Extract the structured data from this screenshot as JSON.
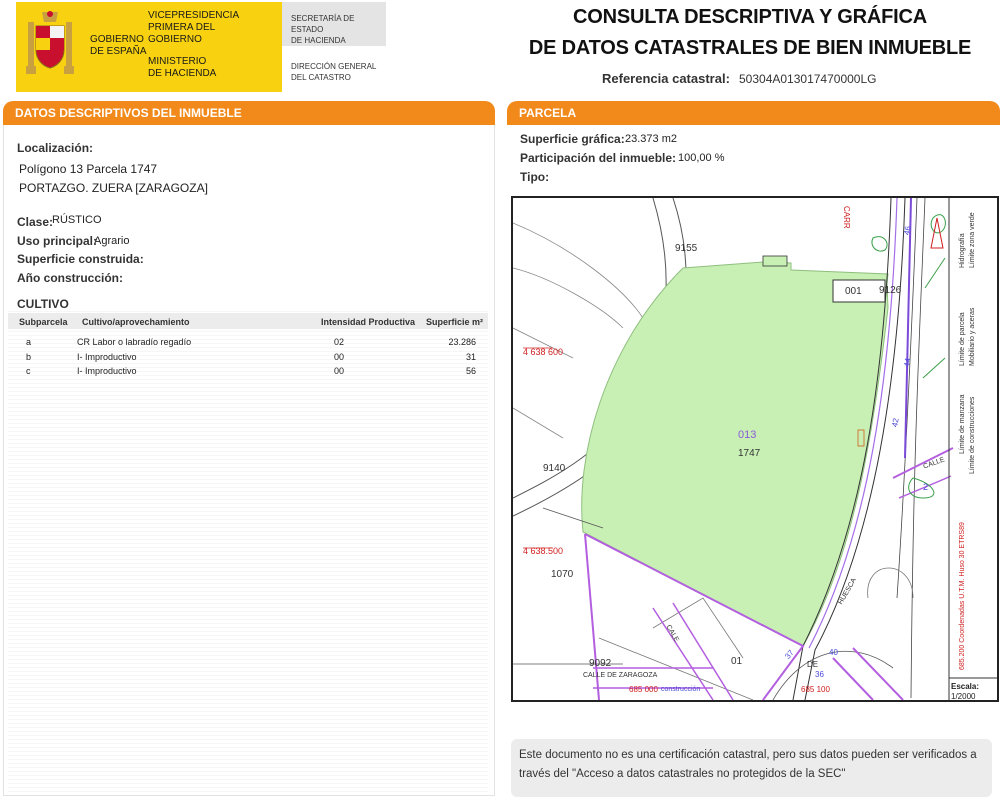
{
  "header": {
    "gobierno": "GOBIERNO\nDE ESPAÑA",
    "vicepresidencia": "VICEPRESIDENCIA\nPRIMERA DEL GOBIERNO",
    "ministerio": "MINISTERIO\nDE HACIENDA",
    "secretaria": "SECRETARÍA DE ESTADO\nDE HACIENDA",
    "direccion": "DIRECCIÓN GENERAL\nDEL CATASTRO",
    "title_line1": "CONSULTA DESCRIPTIVA Y GRÁFICA",
    "title_line2": "DE DATOS CATASTRALES DE BIEN INMUEBLE",
    "ref_label": "Referencia catastral:",
    "ref_value": "50304A013017470000LG",
    "brand_color": "#f8d210"
  },
  "left": {
    "section_title": "DATOS DESCRIPTIVOS DEL INMUEBLE",
    "localizacion_label": "Localización:",
    "localizacion_line1": "Polígono 13 Parcela 1747",
    "localizacion_line2": "PORTAZGO. ZUERA [ZARAGOZA]",
    "clase_label": "Clase:",
    "clase_value": "RÚSTICO",
    "uso_label": "Uso principal:",
    "uso_value": "Agrario",
    "superficie_label": "Superficie construida:",
    "anio_label": "Año construcción:",
    "cultivo_title": "CULTIVO",
    "cultivo_headers": {
      "subparcela": "Subparcela",
      "cultivo": "Cultivo/aprovechamiento",
      "intensidad": "Intensidad Productiva",
      "superficie": "Superficie m²"
    },
    "cultivo_rows": [
      {
        "subparcela": "a",
        "cultivo": "CR Labor o labradío regadío",
        "intensidad": "02",
        "superficie": "23.286"
      },
      {
        "subparcela": "b",
        "cultivo": "I- Improductivo",
        "intensidad": "00",
        "superficie": "31"
      },
      {
        "subparcela": "c",
        "cultivo": "I- Improductivo",
        "intensidad": "00",
        "superficie": "56"
      }
    ]
  },
  "right": {
    "section_title": "PARCELA",
    "sup_grafica_label": "Superficie gráfica:",
    "sup_grafica_value": "23.373 m2",
    "participacion_label": "Participación del inmueble:",
    "participacion_value": "100,00 %",
    "tipo_label": "Tipo:",
    "accent_color": "#f28a1b",
    "parcel_fill": "#c8f0b4"
  },
  "map": {
    "label_9155": "9155",
    "label_001": "001",
    "label_9126": "9126",
    "coord_600": "4 638 600",
    "coord_500": "4 638.500",
    "label_9140": "9140",
    "label_1070": "1070",
    "label_013": "013",
    "label_1747": "1747",
    "label_9092": "9092",
    "label_01": "01",
    "label_carr": "CARR",
    "label_calle": "CALLE",
    "label_2": "2",
    "label_huesca": "HUESCA",
    "label_de": "DE",
    "label_37": "37",
    "label_40": "40",
    "label_36": "36",
    "label_44": "44",
    "label_46": "46",
    "label_42": "42",
    "label_cale": "CALE",
    "label_calle_zaragoza": "CALLE DE ZARAGOZA",
    "label_685000": "685 000",
    "label_685100": "685 100",
    "label_construccion": "construcción",
    "label_hidrografia": "Hidrografía",
    "label_limite_parcela": "Límite de parcela",
    "label_limite_manzana": "Límite de manzana",
    "label_limite_zona_verde": "Límite zona verde",
    "label_mobiliario": "Mobiliario y aceras",
    "label_limite_construcciones": "Límite de construcciones",
    "coords_legend": "685.200 Coordenadas U.T.M. Huso 30 ETRS89",
    "escala_label": "Escala:",
    "escala_value": "1/2000"
  },
  "note": {
    "text": "Este documento no es una certificación catastral, pero sus datos pueden ser verificados a través del \"Acceso a datos catastrales no protegidos de la SEC\""
  }
}
